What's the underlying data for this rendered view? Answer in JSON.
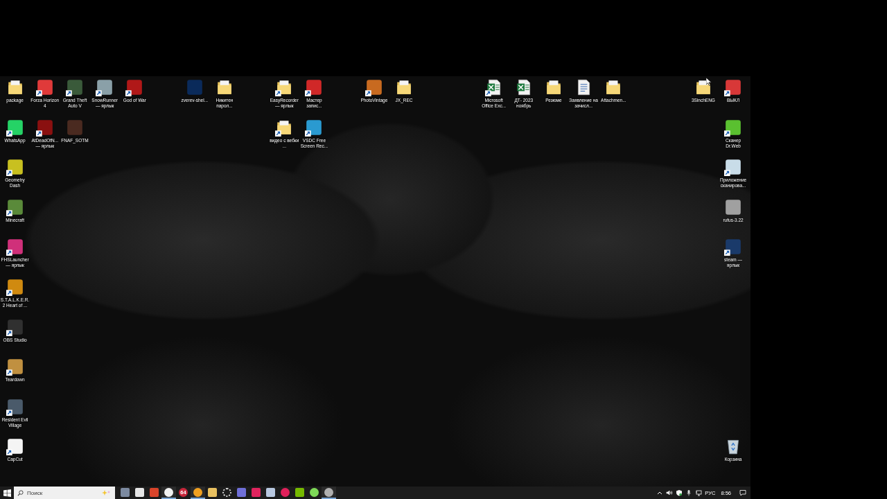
{
  "desktop_icons": [
    {
      "label": "package",
      "kind": "folder",
      "shortcut": false
    },
    {
      "label": "Forza Horizon 4",
      "kind": "app",
      "color": "#e03a3a",
      "shortcut": true
    },
    {
      "label": "Grand Theft Auto V",
      "kind": "app",
      "color": "#3a5a3a",
      "shortcut": true
    },
    {
      "label": "SnowRunner — ярлык",
      "kind": "app",
      "color": "#8aa0a8",
      "shortcut": true
    },
    {
      "label": "God of War",
      "kind": "app",
      "color": "#b01818",
      "shortcut": true
    },
    {
      "label": "zverev-shel...",
      "kind": "app",
      "color": "#0a2a5a",
      "shortcut": false
    },
    {
      "label": "Никитен парол...",
      "kind": "folder",
      "shortcut": false
    },
    {
      "label": "EasyRecorder — ярлык",
      "kind": "folder",
      "shortcut": true
    },
    {
      "label": "Мастер запис...",
      "kind": "app",
      "color": "#d02828",
      "shortcut": true
    },
    {
      "label": "PhotoVintage",
      "kind": "app",
      "color": "#c86a20",
      "shortcut": true
    },
    {
      "label": "JX_REC",
      "kind": "folder",
      "shortcut": false
    },
    {
      "label": "Microsoft Office Exc...",
      "kind": "spreadsheet",
      "shortcut": true
    },
    {
      "label": "ДТ- 2023 ноябрь",
      "kind": "spreadsheet",
      "shortcut": false
    },
    {
      "label": "Резюме",
      "kind": "folder",
      "shortcut": false
    },
    {
      "label": "Заявление на зачисл...",
      "kind": "document",
      "shortcut": false
    },
    {
      "label": "Attachmen...",
      "kind": "folder",
      "shortcut": false
    },
    {
      "label": "3SinchENG",
      "kind": "folder",
      "shortcut": false
    },
    {
      "label": "ВЫКЛ",
      "kind": "app",
      "color": "#d83838",
      "shortcut": true
    },
    {
      "label": "WhatsApp",
      "kind": "app",
      "color": "#25d366",
      "shortcut": true
    },
    {
      "label": "AtDeadOfN... — ярлык",
      "kind": "app",
      "color": "#8a1010",
      "shortcut": true
    },
    {
      "label": "FNAF_SOTM",
      "kind": "app",
      "color": "#4a2a20",
      "shortcut": false
    },
    {
      "label": "видео с вебки ...",
      "kind": "folder",
      "shortcut": true
    },
    {
      "label": "VSDC Free Screen Rec...",
      "kind": "app",
      "color": "#2a9ad0",
      "shortcut": true
    },
    {
      "label": "Сканер Dr.Web",
      "kind": "app",
      "color": "#5ac030",
      "shortcut": true
    },
    {
      "label": "Geometry Dash",
      "kind": "app",
      "color": "#c8c020",
      "shortcut": true
    },
    {
      "label": "Приложение сканирова...",
      "kind": "app",
      "color": "#c8dce8",
      "shortcut": true
    },
    {
      "label": "Minecraft",
      "kind": "app",
      "color": "#5a8a3a",
      "shortcut": true
    },
    {
      "label": "rufus-3.22",
      "kind": "app",
      "color": "#a0a0a0",
      "shortcut": false
    },
    {
      "label": "FHSLauncher — ярлык",
      "kind": "app",
      "color": "#d0307a",
      "shortcut": true
    },
    {
      "label": "steam — ярлык",
      "kind": "app",
      "color": "#1a3a6a",
      "shortcut": true
    },
    {
      "label": "S.T.A.L.K.E.R. 2 Heart of ...",
      "kind": "app",
      "color": "#d08a10",
      "shortcut": true
    },
    {
      "label": "OBS Studio",
      "kind": "app",
      "color": "#303030",
      "shortcut": true
    },
    {
      "label": "Teardown",
      "kind": "app",
      "color": "#c09040",
      "shortcut": true
    },
    {
      "label": "Resident Evil Village",
      "kind": "app",
      "color": "#4a5a6a",
      "shortcut": true
    },
    {
      "label": "CapCut",
      "kind": "app",
      "color": "#f4f4f4",
      "shortcut": true
    },
    {
      "label": "Корзина",
      "kind": "recycle-bin",
      "shortcut": false
    }
  ],
  "taskbar": {
    "search": {
      "placeholder": "Поиск"
    },
    "apps": [
      {
        "kind": "tile",
        "color": "#7c8aa0",
        "running": false
      },
      {
        "kind": "tile",
        "color": "#e6e6e6",
        "running": false
      },
      {
        "kind": "tile",
        "color": "#d9442a",
        "running": false
      },
      {
        "kind": "circle",
        "color": "#f2f2f2",
        "running": true
      },
      {
        "kind": "circle",
        "color": "#c8283c",
        "running": false,
        "label": "64"
      },
      {
        "kind": "circle",
        "color": "#f0a020",
        "running": true
      },
      {
        "kind": "tile",
        "color": "#e8c060",
        "running": false
      },
      {
        "kind": "gear",
        "color": "#e0e0e0",
        "running": false
      },
      {
        "kind": "tile",
        "color": "#6f6fd8",
        "running": false
      },
      {
        "kind": "tile",
        "color": "#e0245e",
        "running": false
      },
      {
        "kind": "tile",
        "color": "#b8c8e0",
        "running": false
      },
      {
        "kind": "circle",
        "color": "#e0205a",
        "running": false
      },
      {
        "kind": "tile",
        "color": "#76b900",
        "running": false
      },
      {
        "kind": "circle",
        "color": "#7ed957",
        "running": false
      },
      {
        "kind": "circle",
        "color": "#b0b0b0",
        "running": true
      }
    ],
    "language": "РУС",
    "time": "8:56"
  }
}
